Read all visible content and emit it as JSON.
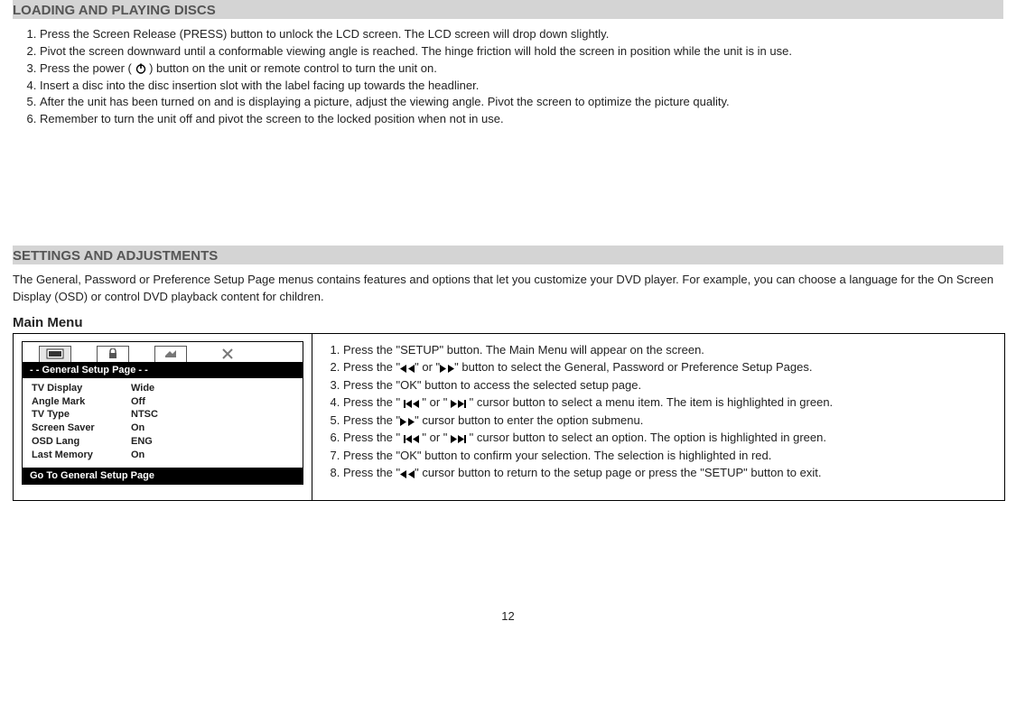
{
  "section1": {
    "title": "LOADING AND PLAYING DISCS",
    "steps": [
      "Press the Screen Release (PRESS) button to unlock the LCD screen. The LCD screen will drop down slightly.",
      "Pivot the screen downward until a conformable viewing angle is reached. The hinge friction will hold the screen in position while the unit is in use.",
      {
        "pre": "Press the power ( ",
        "icon": "power-icon",
        "post": " ) button on the unit or remote control to turn the unit on."
      },
      "Insert a disc into the disc insertion slot with the label facing up towards the headliner.",
      "After the unit has been turned on and is displaying a picture, adjust the viewing angle. Pivot the screen to optimize the picture quality.",
      "Remember to turn the unit off and pivot the screen to the locked position when not in use."
    ]
  },
  "section2": {
    "title": "SETTINGS AND ADJUSTMENTS",
    "intro": "The General, Password or Preference Setup Page menus contains features and options that let you customize your DVD player. For example, you can choose a language for the On Screen Display (OSD) or control DVD playback content for children.",
    "subheader": "Main Menu",
    "osd": {
      "band_title": "- - General Setup Page - -",
      "rows": [
        {
          "k": "TV Display",
          "v": "Wide"
        },
        {
          "k": "Angle Mark",
          "v": "Off"
        },
        {
          "k": "TV Type",
          "v": "NTSC"
        },
        {
          "k": "Screen Saver",
          "v": "On"
        },
        {
          "k": "OSD Lang",
          "v": "ENG"
        },
        {
          "k": "Last Memory",
          "v": "On"
        }
      ],
      "footer": "Go  To  General  Setup  Page"
    },
    "steps": [
      "Press the \"SETUP\" button. The Main Menu will appear on the screen.",
      {
        "parts": [
          "Press the \"",
          {
            "icon": "dleft-icon"
          },
          "\" or \"",
          {
            "icon": "dright-icon"
          },
          "\" button to select the General, Password or Preference Setup Pages."
        ]
      },
      "Press the \"OK\" button to access the selected setup page.",
      {
        "parts": [
          "Press the \" ",
          {
            "icon": "skipback-icon"
          },
          " \" or \" ",
          {
            "icon": "skipfwd-icon"
          },
          " \" cursor button to select a menu item. The item is highlighted in green."
        ]
      },
      {
        "parts": [
          "Press the \"",
          {
            "icon": "dright-icon"
          },
          "\" cursor button to enter the option submenu."
        ]
      },
      {
        "parts": [
          "Press the \" ",
          {
            "icon": "skipback-icon"
          },
          " \" or \" ",
          {
            "icon": "skipfwd-icon"
          },
          " \" cursor button to select an option. The option is highlighted in green."
        ]
      },
      "Press the \"OK\" button to confirm your selection. The selection is highlighted in red.",
      {
        "parts": [
          "Press the \"",
          {
            "icon": "dleft-icon"
          },
          "\" cursor button to return to the setup page or press the \"SETUP\" button to exit."
        ]
      }
    ]
  },
  "page_number": "12"
}
